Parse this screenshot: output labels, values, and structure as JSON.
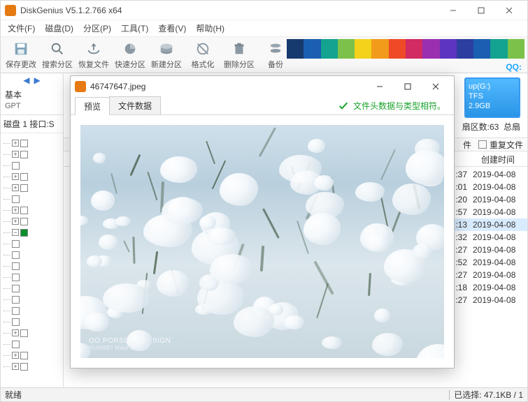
{
  "app": {
    "title": "DiskGenius V5.1.2.766 x64",
    "status_ready": "就绪",
    "status_selected": "已选择: 47.1KB / 1"
  },
  "menu": {
    "file": "文件(F)",
    "disk": "磁盘(D)",
    "partition": "分区(P)",
    "tool": "工具(T)",
    "view": "查看(V)",
    "help": "帮助(H)"
  },
  "toolbar": {
    "save": "保存更改",
    "search_part": "搜索分区",
    "recover": "恢复文件",
    "quick_part": "快速分区",
    "new_part": "新建分区",
    "format": "格式化",
    "del_part": "删除分区",
    "backup": "备份",
    "qq": "QQ:"
  },
  "left": {
    "basic": "基本",
    "gpt": "GPT",
    "disk_line": "磁盘 1  接口:S"
  },
  "volume": {
    "name": "up(G:)",
    "fs": "TFS",
    "size": "2.9GB"
  },
  "cylinders": {
    "label": "扇区数:",
    "value": "63",
    "total": "总扇"
  },
  "list": {
    "header_suffix": "件",
    "dup_label": "重复文件",
    "col_time": "创建时间"
  },
  "rows": [
    {
      "sec": ":37",
      "date": "2019-04-08"
    },
    {
      "sec": ":01",
      "date": "2019-04-08"
    },
    {
      "sec": ":20",
      "date": "2019-04-08"
    },
    {
      "sec": ":57",
      "date": "2019-04-08"
    },
    {
      "sec": ":13",
      "date": "2019-04-08",
      "sel": true
    },
    {
      "sec": ":32",
      "date": "2019-04-08"
    },
    {
      "sec": ":27",
      "date": "2019-04-08"
    },
    {
      "sec": ":52",
      "date": "2019-04-08"
    },
    {
      "sec": ":27",
      "date": "2019-04-08"
    },
    {
      "sec": ":18",
      "date": "2019-04-08"
    },
    {
      "sec": ":27",
      "date": "2019-04-08"
    }
  ],
  "preview": {
    "title": "46747647.jpeg",
    "tab_preview": "预览",
    "tab_file_data": "文件数据",
    "hint": "文件头数据与类型相符。",
    "watermark_line1": "OO PORSCHE DESIGN",
    "watermark_line2": "HUAWEI  Mate 10 RS"
  },
  "rainbow": [
    "#173a6e",
    "#1b5fb2",
    "#13a390",
    "#7bc14a",
    "#f2d21b",
    "#f29a1b",
    "#ef4a27",
    "#d22a62",
    "#9a2fb0",
    "#5d34c1",
    "#2c3ea0",
    "#1b5fb2",
    "#13a390",
    "#7bc14a"
  ]
}
